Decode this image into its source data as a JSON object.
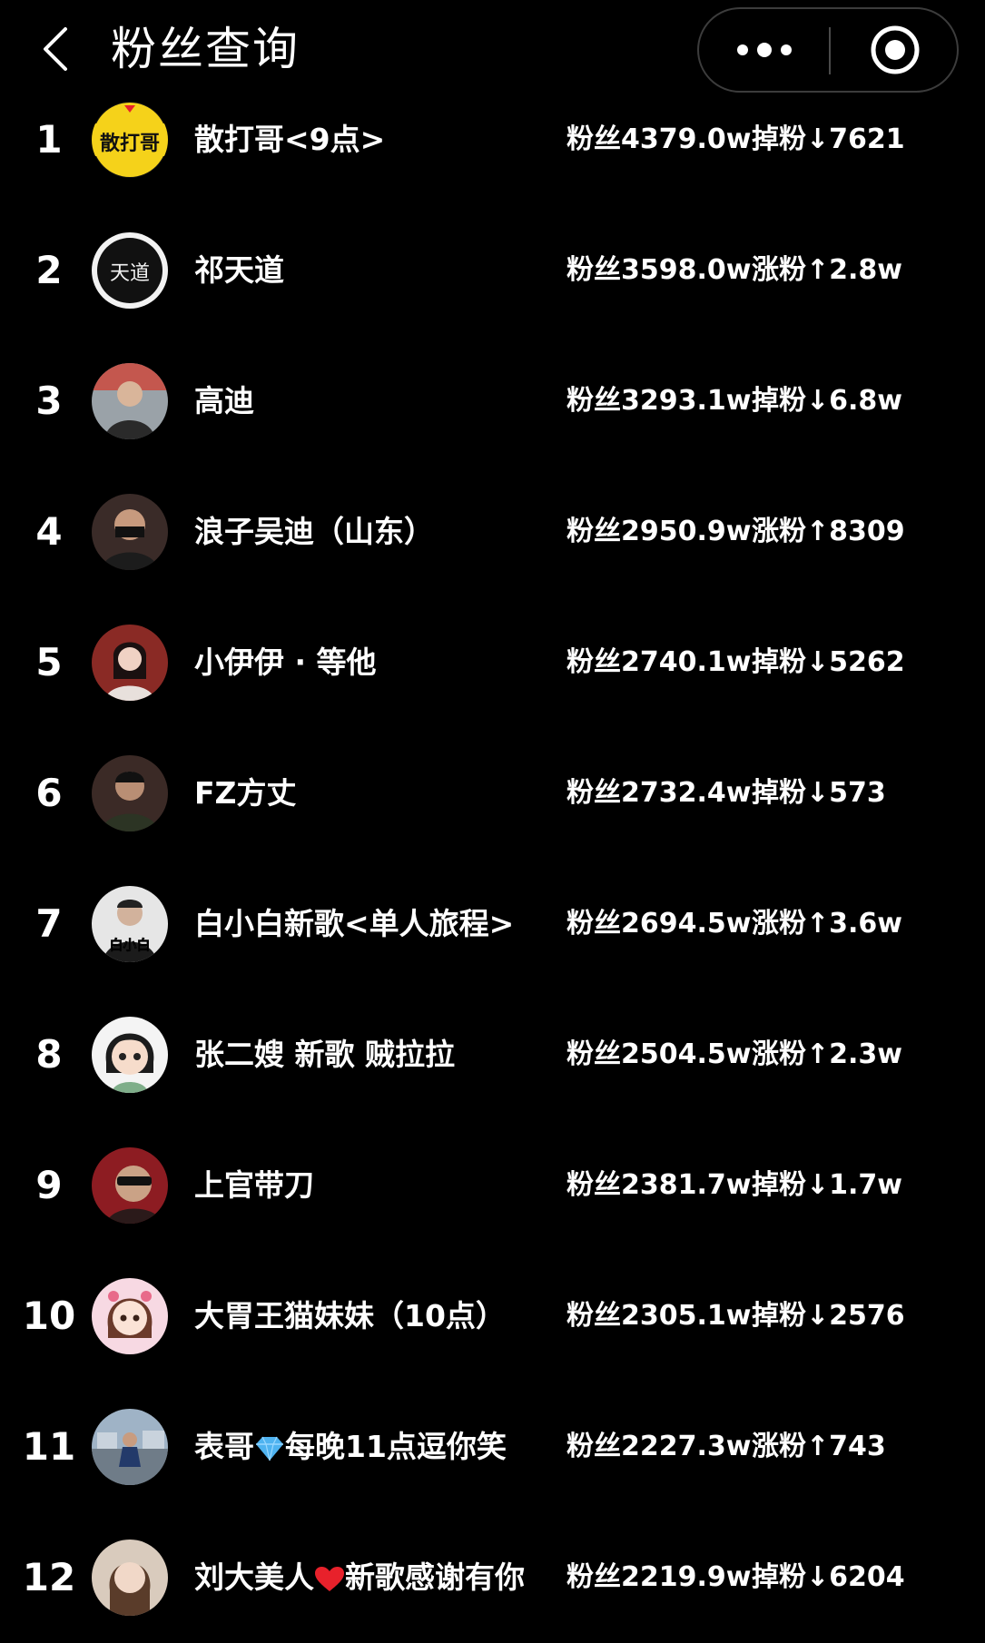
{
  "header": {
    "title": "粉丝查询",
    "back_icon": "chevron-left-icon",
    "more_icon": "more-dots-icon",
    "close_icon": "target-close-icon"
  },
  "rows": [
    {
      "rank": "1",
      "name": "散打哥<9点>",
      "followers": "粉丝4379.0w",
      "change": "掉粉↓7621"
    },
    {
      "rank": "2",
      "name": "祁天道",
      "followers": "粉丝3598.0w",
      "change": "涨粉↑2.8w"
    },
    {
      "rank": "3",
      "name": "高迪",
      "followers": "粉丝3293.1w",
      "change": "掉粉↓6.8w"
    },
    {
      "rank": "4",
      "name": "浪子吴迪（山东）",
      "followers": "粉丝2950.9w",
      "change": "涨粉↑8309"
    },
    {
      "rank": "5",
      "name": "小伊伊 · 等他",
      "followers": "粉丝2740.1w",
      "change": "掉粉↓5262"
    },
    {
      "rank": "6",
      "name": "FZ方丈",
      "followers": "粉丝2732.4w",
      "change": "掉粉↓573"
    },
    {
      "rank": "7",
      "name": "白小白新歌<单人旅程>",
      "followers": "粉丝2694.5w",
      "change": "涨粉↑3.6w"
    },
    {
      "rank": "8",
      "name": "张二嫂 新歌 贼拉拉",
      "followers": "粉丝2504.5w",
      "change": "涨粉↑2.3w"
    },
    {
      "rank": "9",
      "name": "上官带刀",
      "followers": "粉丝2381.7w",
      "change": "掉粉↓1.7w"
    },
    {
      "rank": "10",
      "name": "大胃王猫妹妹（10点）",
      "followers": "粉丝2305.1w",
      "change": "掉粉↓2576"
    },
    {
      "rank": "11",
      "name_before": "表哥",
      "name_icon": "diamond-icon",
      "name_after": "每晚11点逗你笑",
      "followers": "粉丝2227.3w",
      "change": "涨粉↑743"
    },
    {
      "rank": "12",
      "name_before": "刘大美人",
      "name_icon": "heart-icon",
      "name_after": "新歌感谢有你",
      "followers": "粉丝2219.9w",
      "change": "掉粉↓6204"
    }
  ],
  "avatar_logo_text": {
    "row1": "散打哥",
    "row2": "天道",
    "row7": "白小白"
  },
  "colors": {
    "background": "#000000",
    "text": "#ffffff",
    "diamond": "#4fb3f0",
    "heart": "#e8212b",
    "logo_yellow": "#f5d21a"
  }
}
